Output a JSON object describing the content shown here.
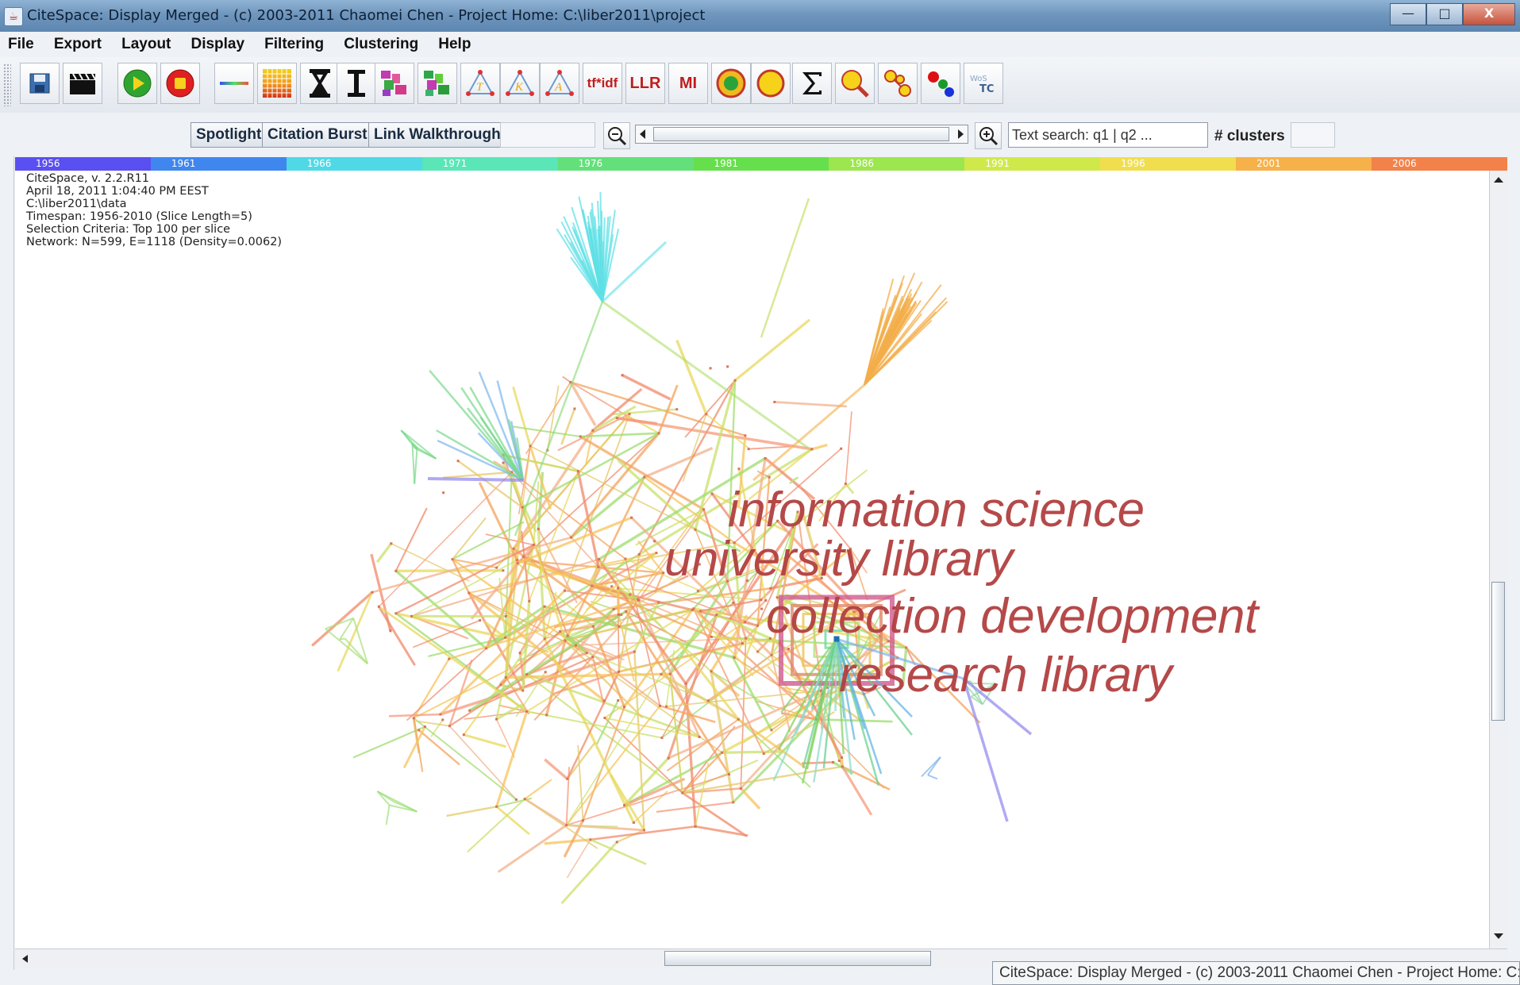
{
  "window": {
    "title": "CiteSpace: Display Merged - (c) 2003-2011 Chaomei Chen - Project Home: C:\\liber2011\\project",
    "controls": {
      "minimize": "—",
      "maximize": "□",
      "close": "X"
    }
  },
  "menubar": {
    "items": [
      "File",
      "Export",
      "Layout",
      "Display",
      "Filtering",
      "Clustering",
      "Help"
    ]
  },
  "toolbar": {
    "text_buttons": {
      "tfidf": "tf*idf",
      "llr": "LLR",
      "mi": "MI"
    },
    "icons": [
      "save-icon",
      "clapperboard-icon",
      "play-icon",
      "stop-icon",
      "color-line-icon",
      "color-grid-icon",
      "hourglass-icon",
      "i-beam-icon",
      "cluster-view-red-icon",
      "cluster-view-green-icon",
      "triangle-t-icon",
      "triangle-k-icon",
      "triangle-a-icon",
      "tfidf",
      "llr",
      "mi",
      "target-icon",
      "yellow-circle-icon",
      "sigma-icon",
      "magnify-yellow-icon",
      "link-circles-icon",
      "colored-dots-icon",
      "wos-tc-icon"
    ]
  },
  "nav": {
    "spotlight": "Spotlight",
    "citation_burst": "Citation Burst",
    "link_walkthrough": "Link Walkthrough",
    "text_search_placeholder": "Text search: q1 | q2 ...",
    "clusters_label": "# clusters"
  },
  "timeline": {
    "years": [
      "1956",
      "1961",
      "1966",
      "1971",
      "1976",
      "1981",
      "1986",
      "1991",
      "1996",
      "2001",
      "2006"
    ],
    "colors": [
      "#5a4ff0",
      "#3f86ef",
      "#4fd9e6",
      "#5ae6b6",
      "#63e07a",
      "#66df4d",
      "#9ce64e",
      "#cfe94b",
      "#f0de4f",
      "#f7b149",
      "#f3824a"
    ]
  },
  "info": {
    "lines": [
      "CiteSpace, v. 2.2.R11",
      "April 18, 2011 1:04:40 PM EEST",
      "C:\\liber2011\\data",
      "Timespan: 1956-2010 (Slice Length=5)",
      "Selection Criteria: Top 100 per slice",
      "Network: N=599, E=1118 (Density=0.0062)"
    ]
  },
  "clusters": {
    "labels": [
      "information science",
      "university library",
      "collection development",
      "research library"
    ],
    "label_color": "#b24040"
  },
  "statusbar": {
    "text": "CiteSpace: Display Merged - (c) 2003-2011 Chaomei Chen - Project Home: C:\\liber"
  }
}
